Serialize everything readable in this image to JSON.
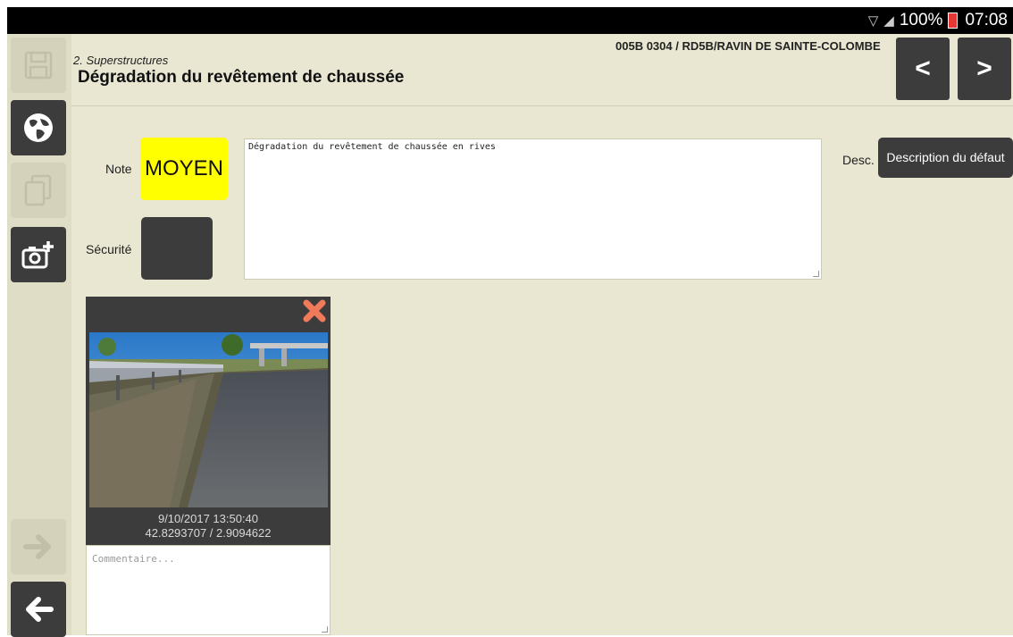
{
  "statusbar": {
    "battery": "100%",
    "time": "07:08",
    "icons": [
      "wifi-icon",
      "signal-icon",
      "battery-icon"
    ]
  },
  "sidebar": {
    "items": [
      {
        "name": "save-icon",
        "state": "disabled"
      },
      {
        "name": "globe-icon",
        "state": "active"
      },
      {
        "name": "copy-icon",
        "state": "disabled"
      },
      {
        "name": "camera-add-icon",
        "state": "active"
      },
      {
        "name": "arrow-right-icon",
        "state": "disabled"
      },
      {
        "name": "arrow-left-icon",
        "state": "active"
      }
    ]
  },
  "header": {
    "section": "2. Superstructures",
    "title": "Dégradation du revêtement de chaussée",
    "location": "005B 0304 / RD5B/RAVIN DE SAINTE-COLOMBE",
    "prev_label": "<",
    "next_label": ">"
  },
  "form": {
    "note_label": "Note",
    "note_value": "MOYEN",
    "note_color": "#ffff00",
    "securite_label": "Sécurité",
    "description_text": "Dégradation du revêtement de chaussée en rives",
    "desc_label": "Desc.",
    "desc_button": "Description du défaut"
  },
  "photo": {
    "datetime": "9/10/2017 13:50:40",
    "coords": "42.8293707 / 2.9094622",
    "comment_placeholder": "Commentaire..."
  },
  "colors": {
    "background": "#e9e6d2",
    "button_dark": "#3c3c3c",
    "close_icon": "#f07a5a"
  }
}
